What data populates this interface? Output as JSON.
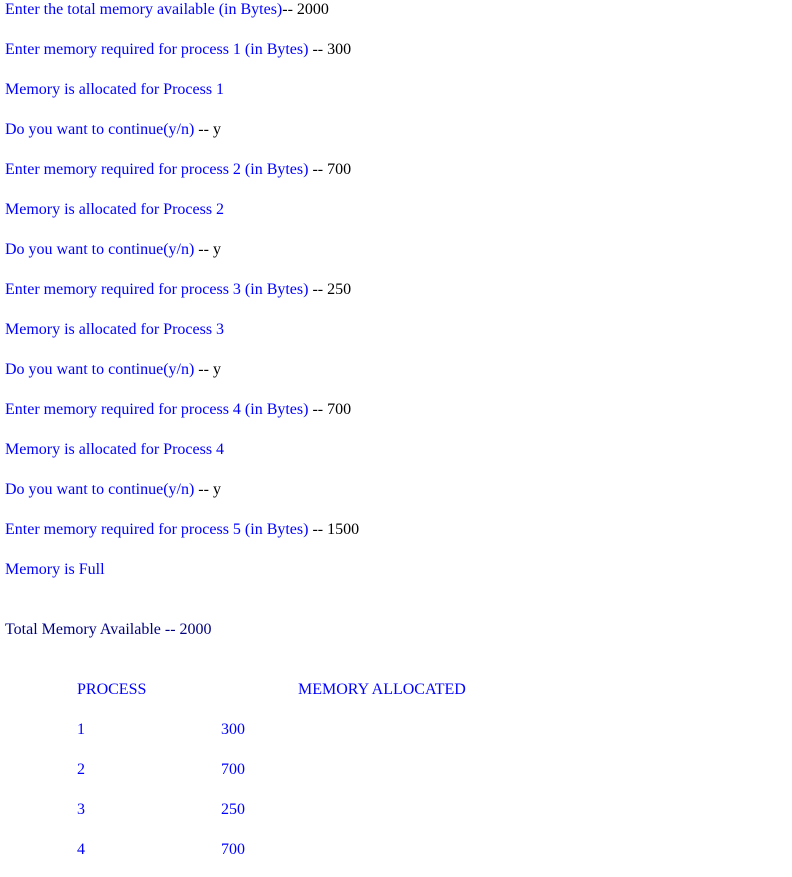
{
  "lines": [
    {
      "prompt": "Enter the total memory available (in Bytes)",
      "sep": "--",
      "value": " 2000"
    },
    {
      "prompt": "Enter memory required for process 1 (in Bytes) ",
      "sep": "--",
      "value": " 300"
    },
    {
      "prompt": "Memory is allocated for Process 1",
      "sep": "",
      "value": ""
    },
    {
      "prompt": "Do you want to continue(y/n) ",
      "sep": "--",
      "value": " y"
    },
    {
      "prompt": "Enter memory required for process 2 (in Bytes) ",
      "sep": "--",
      "value": " 700"
    },
    {
      "prompt": "Memory is allocated for Process 2",
      "sep": "",
      "value": ""
    },
    {
      "prompt": "Do you want to continue(y/n) ",
      "sep": "--",
      "value": " y"
    },
    {
      "prompt": "Enter memory required for process 3 (in Bytes) ",
      "sep": "--",
      "value": " 250"
    },
    {
      "prompt": "Memory is allocated for Process 3",
      "sep": "",
      "value": ""
    },
    {
      "prompt": "Do you want to continue(y/n) ",
      "sep": "--",
      "value": " y"
    },
    {
      "prompt": "Enter memory required for process 4 (in Bytes) ",
      "sep": "--",
      "value": " 700"
    },
    {
      "prompt": "Memory is allocated for Process 4",
      "sep": "",
      "value": ""
    },
    {
      "prompt": "Do you want to continue(y/n) ",
      "sep": "--",
      "value": " y"
    },
    {
      "prompt": "Enter memory required for process 5 (in Bytes) ",
      "sep": "--",
      "value": " 1500"
    },
    {
      "prompt": "Memory is Full",
      "sep": "",
      "value": ""
    }
  ],
  "summary": {
    "total_label": "Total Memory Available -- 2000"
  },
  "table": {
    "headers": [
      "PROCESS",
      "MEMORY ALLOCATED"
    ],
    "rows": [
      [
        "1",
        "300"
      ],
      [
        "2",
        "700"
      ],
      [
        "3",
        "250"
      ],
      [
        "4",
        "700"
      ]
    ]
  },
  "colors": {
    "output_text": "#0000ff",
    "user_input": "#000000"
  }
}
